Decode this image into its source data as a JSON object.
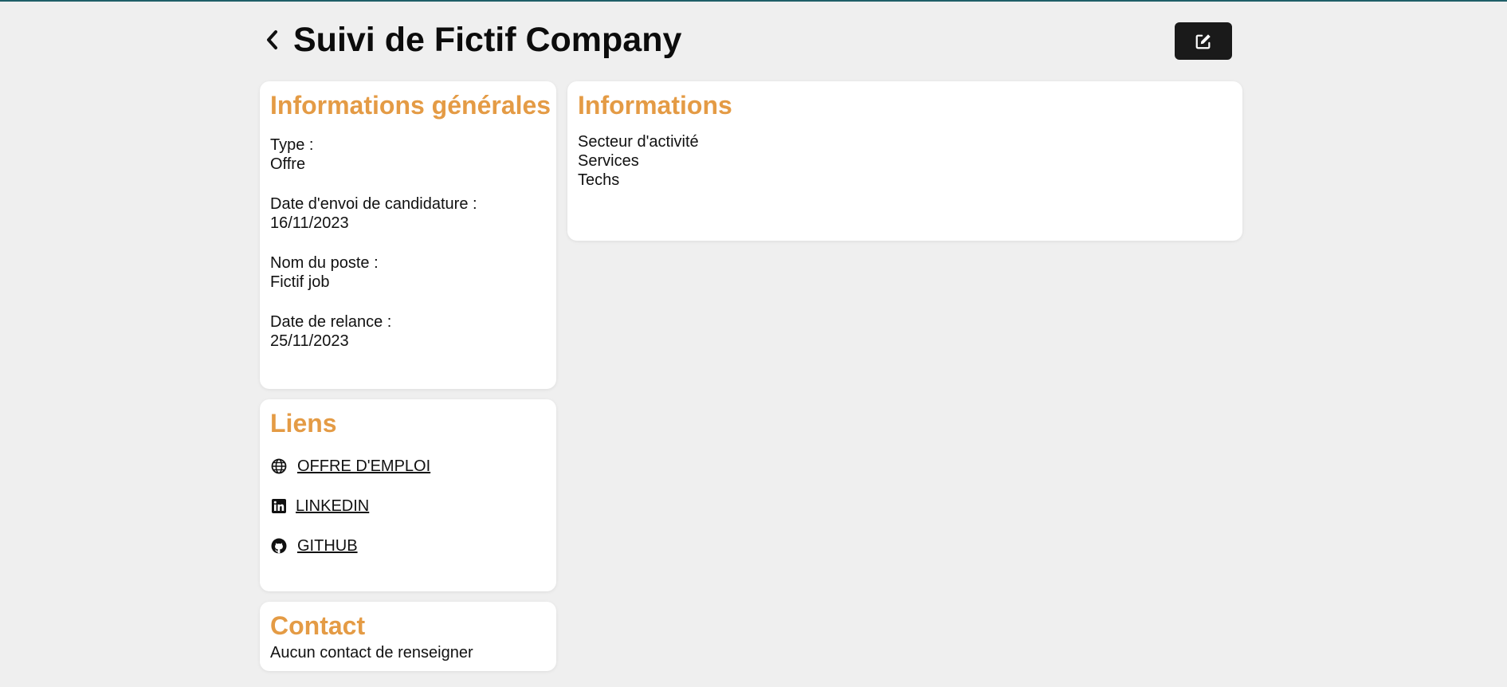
{
  "header": {
    "title": "Suivi de Fictif Company",
    "back_icon": "chevron-left-icon",
    "edit_icon": "edit-icon"
  },
  "colors": {
    "accent": "#e49b45",
    "background": "#efefef",
    "card": "#ffffff",
    "button": "#1a1a1a",
    "top_line": "#1f5f68"
  },
  "general": {
    "title": "Informations générales",
    "fields": [
      {
        "label": "Type :",
        "value": "Offre"
      },
      {
        "label": "Date d'envoi de candidature :",
        "value": "16/11/2023"
      },
      {
        "label": "Nom du poste :",
        "value": "Fictif job"
      },
      {
        "label": "Date de relance :",
        "value": "25/11/2023"
      }
    ]
  },
  "info": {
    "title": "Informations",
    "lines": [
      "Secteur d'activité",
      "Services",
      "Techs"
    ]
  },
  "links": {
    "title": "Liens",
    "items": [
      {
        "label": "OFFRE D'EMPLOI",
        "icon": "globe-icon"
      },
      {
        "label": "LINKEDIN",
        "icon": "linkedin-icon"
      },
      {
        "label": "GITHUB",
        "icon": "github-icon"
      }
    ]
  },
  "contact": {
    "title": "Contact",
    "text": "Aucun contact de renseigner"
  }
}
